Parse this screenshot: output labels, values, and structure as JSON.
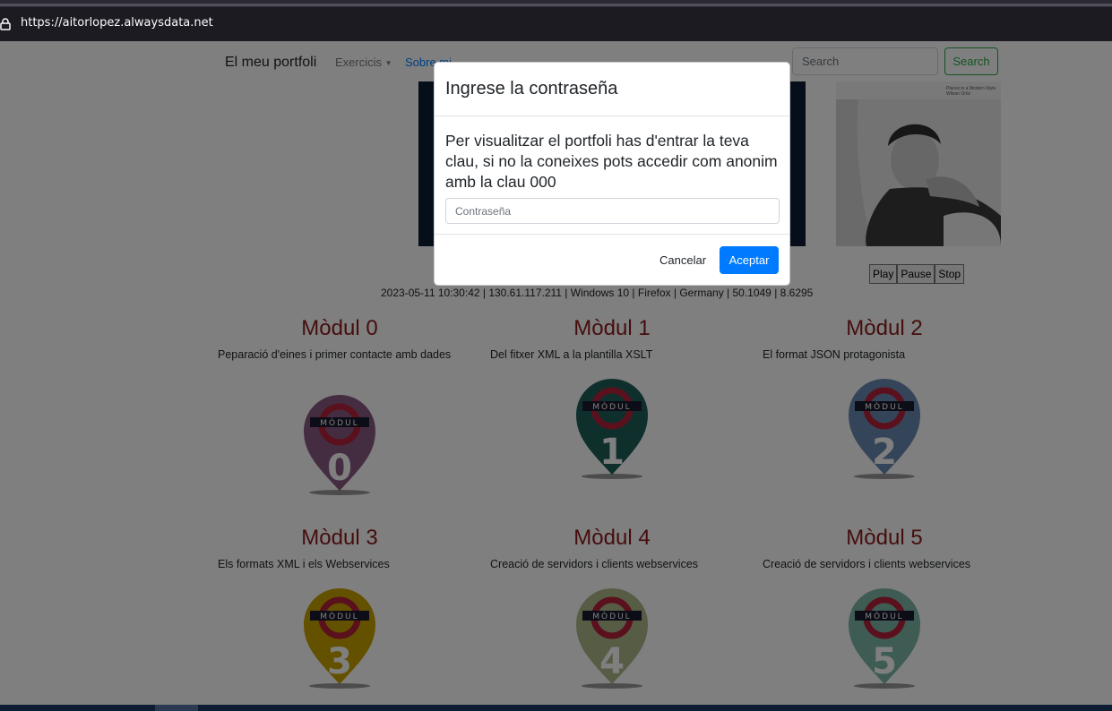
{
  "browser": {
    "url": "https://aitorlopez.alwaysdata.net"
  },
  "navbar": {
    "brand": "El meu portfoli",
    "exercicis": "Exercicis",
    "sobre": "Sobre mi",
    "search_placeholder": "Search",
    "search_button": "Search"
  },
  "banner": {
    "caption_line1": "Places in a Modern Style",
    "caption_line2": "Wilson Ortiz"
  },
  "media": {
    "play": "Play",
    "pause": "Pause",
    "stop": "Stop"
  },
  "info_line": "2023-05-11 10:30:42 | 130.61.117.211 | Windows 10 | Firefox | Germany | 50.1049 | 8.6295",
  "modules": [
    {
      "title": "Mòdul 0",
      "description": "Peparació d'eines i primer contacte amb dades",
      "number": "0",
      "color": "#8b5a83",
      "pin_label": "MÒDUL"
    },
    {
      "title": "Mòdul 1",
      "description": "Del fitxer XML a la plantilla XSLT",
      "number": "1",
      "color": "#1f5e5a",
      "pin_label": "MÒDUL"
    },
    {
      "title": "Mòdul 2",
      "description": "El format JSON protagonista",
      "number": "2",
      "color": "#6b8bb3",
      "pin_label": "MÒDUL"
    },
    {
      "title": "Mòdul 3",
      "description": "Els formats XML i els Webservices",
      "number": "3",
      "color": "#c9a200",
      "pin_label": "MÒDUL"
    },
    {
      "title": "Mòdul 4",
      "description": "Creació de servidors i clients webservices",
      "number": "4",
      "color": "#aeb88a",
      "pin_label": "MÒDUL"
    },
    {
      "title": "Mòdul 5",
      "description": "Creació de servidors i clients webservices",
      "number": "5",
      "color": "#7fb8a8",
      "pin_label": "MÒDUL"
    }
  ],
  "modal": {
    "title": "Ingrese la contraseña",
    "text": "Per visualitzar el portfoli has d'entrar la teva clau, si no la coneixes pots accedir com anonim amb la clau 000",
    "password_placeholder": "Contraseña",
    "cancel": "Cancelar",
    "accept": "Aceptar"
  }
}
